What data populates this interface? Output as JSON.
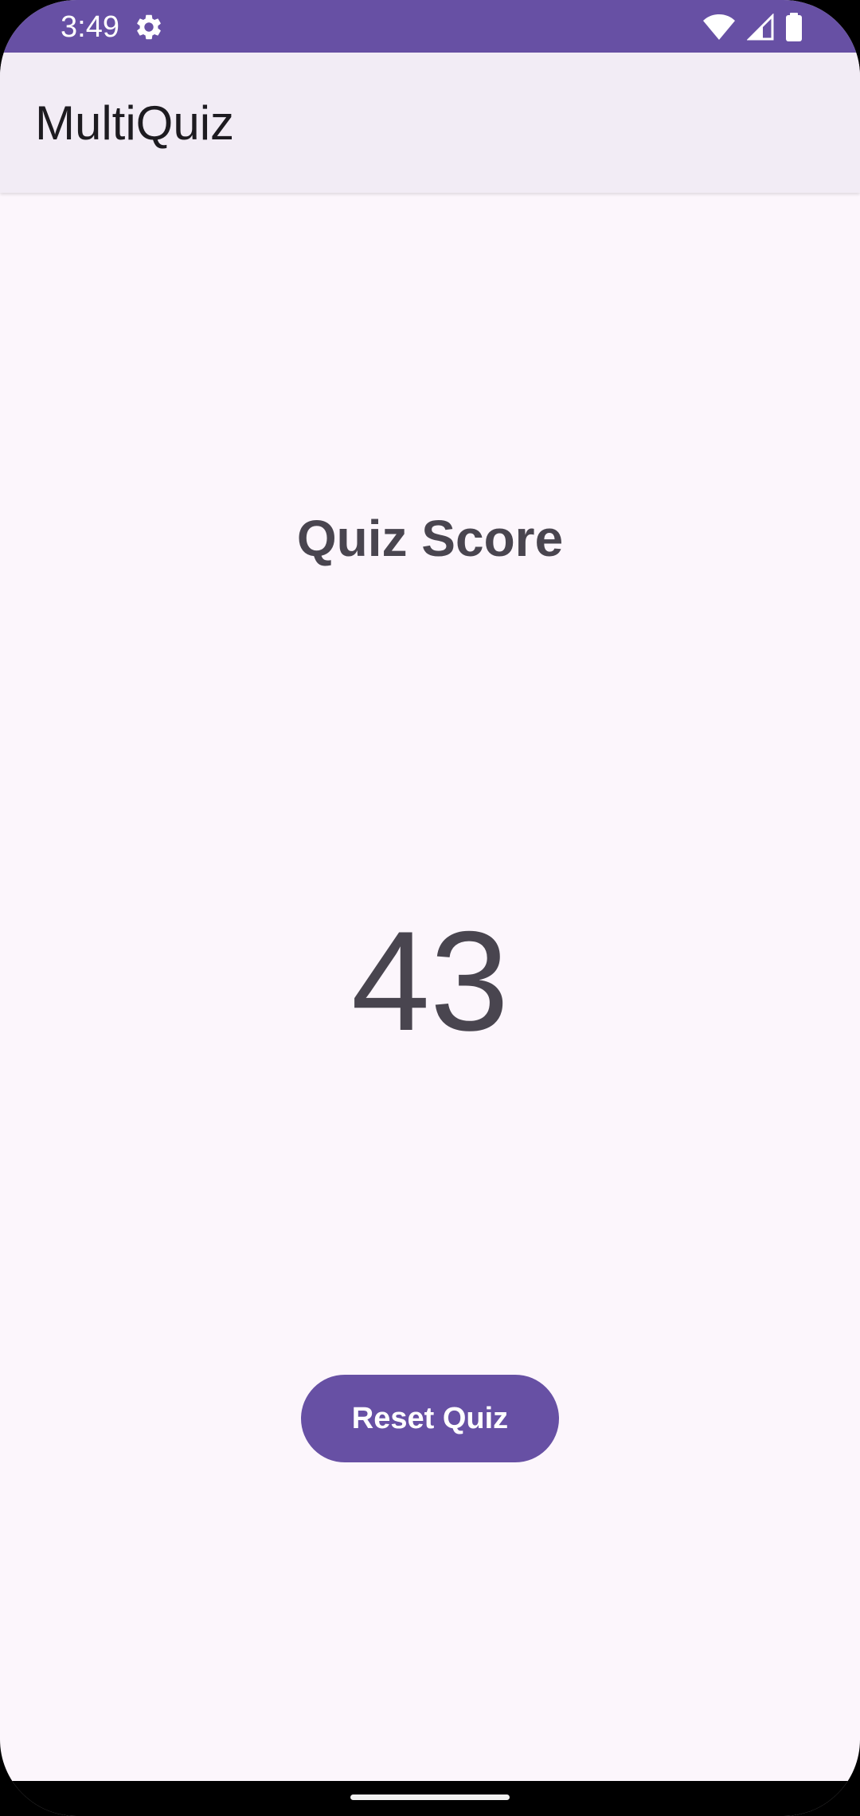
{
  "status_bar": {
    "time": "3:49",
    "icons": [
      "settings-gear-icon",
      "wifi-icon",
      "cell-signal-icon",
      "battery-icon"
    ],
    "background_color": "#6750a4"
  },
  "app_bar": {
    "title": "MultiQuiz",
    "background_color": "#f2ecf5"
  },
  "main": {
    "score_heading": "Quiz Score",
    "score_value": "43",
    "reset_button_label": "Reset Quiz"
  },
  "colors": {
    "accent": "#6750a4",
    "text": "#49454f",
    "surface": "#fcf6fc"
  }
}
